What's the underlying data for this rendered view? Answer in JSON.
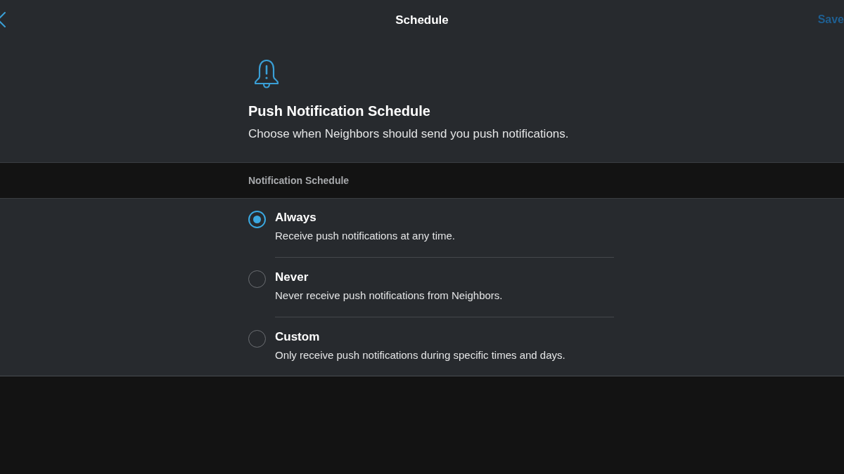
{
  "header": {
    "title": "Schedule",
    "save": {
      "label": "Save",
      "disabled": true
    }
  },
  "intro": {
    "heading": "Push Notification Schedule",
    "description": "Choose when Neighbors should send you push notifications."
  },
  "schedule": {
    "label": "Notification Schedule",
    "options": [
      {
        "title": "Always",
        "description": "Receive push notifications at any time.",
        "selected": true
      },
      {
        "title": "Never",
        "description": "Never receive push notifications from Neighbors.",
        "selected": false
      },
      {
        "title": "Custom",
        "description": "Only receive push notifications during specific times and days.",
        "selected": false
      }
    ]
  }
}
